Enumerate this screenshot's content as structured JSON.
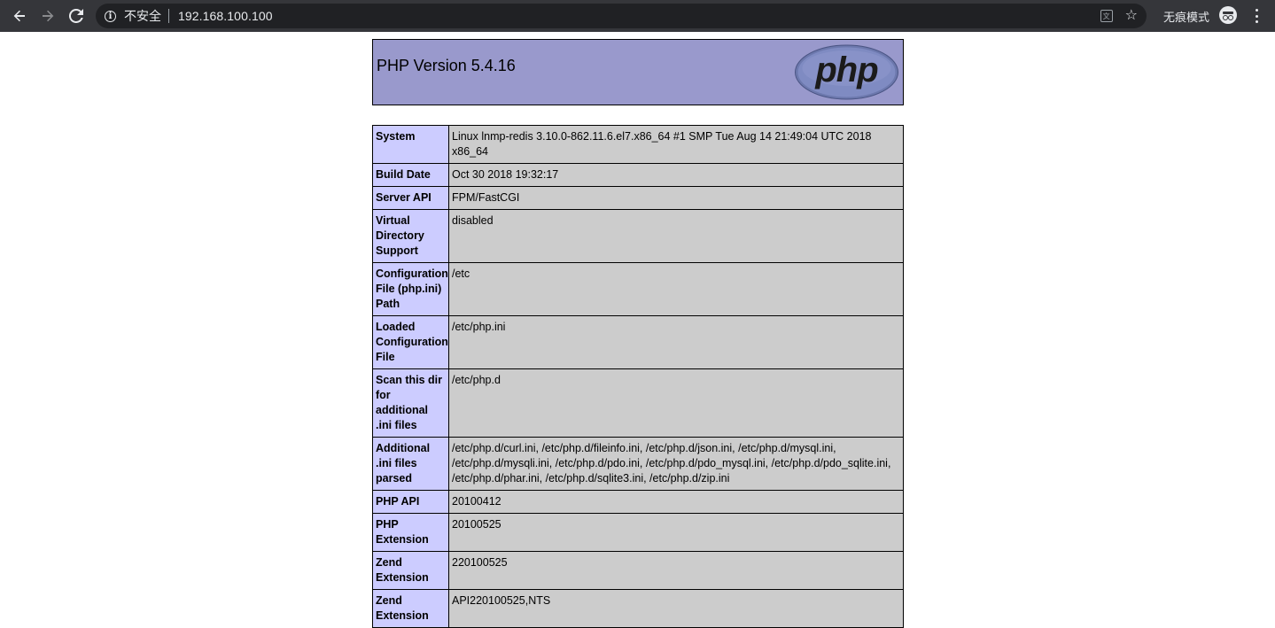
{
  "browser": {
    "security_label": "不安全",
    "url": "192.168.100.100",
    "incognito_label": "无痕模式"
  },
  "phpinfo": {
    "title": "PHP Version 5.4.16",
    "logo_text": "php",
    "rows": [
      {
        "key": "System",
        "value": "Linux lnmp-redis 3.10.0-862.11.6.el7.x86_64 #1 SMP Tue Aug 14 21:49:04 UTC 2018 x86_64"
      },
      {
        "key": "Build Date",
        "value": "Oct 30 2018 19:32:17"
      },
      {
        "key": "Server API",
        "value": "FPM/FastCGI"
      },
      {
        "key": "Virtual Directory Support",
        "value": "disabled"
      },
      {
        "key": "Configuration File (php.ini) Path",
        "value": "/etc"
      },
      {
        "key": "Loaded Configuration File",
        "value": "/etc/php.ini"
      },
      {
        "key": "Scan this dir for additional .ini files",
        "value": "/etc/php.d"
      },
      {
        "key": "Additional .ini files parsed",
        "value": "/etc/php.d/curl.ini, /etc/php.d/fileinfo.ini, /etc/php.d/json.ini, /etc/php.d/mysql.ini, /etc/php.d/mysqli.ini, /etc/php.d/pdo.ini, /etc/php.d/pdo_mysql.ini, /etc/php.d/pdo_sqlite.ini, /etc/php.d/phar.ini, /etc/php.d/sqlite3.ini, /etc/php.d/zip.ini"
      },
      {
        "key": "PHP API",
        "value": "20100412"
      },
      {
        "key": "PHP Extension",
        "value": "20100525"
      },
      {
        "key": "Zend Extension",
        "value": "220100525"
      },
      {
        "key": "Zend Extension",
        "value": "API220100525,NTS"
      }
    ]
  }
}
